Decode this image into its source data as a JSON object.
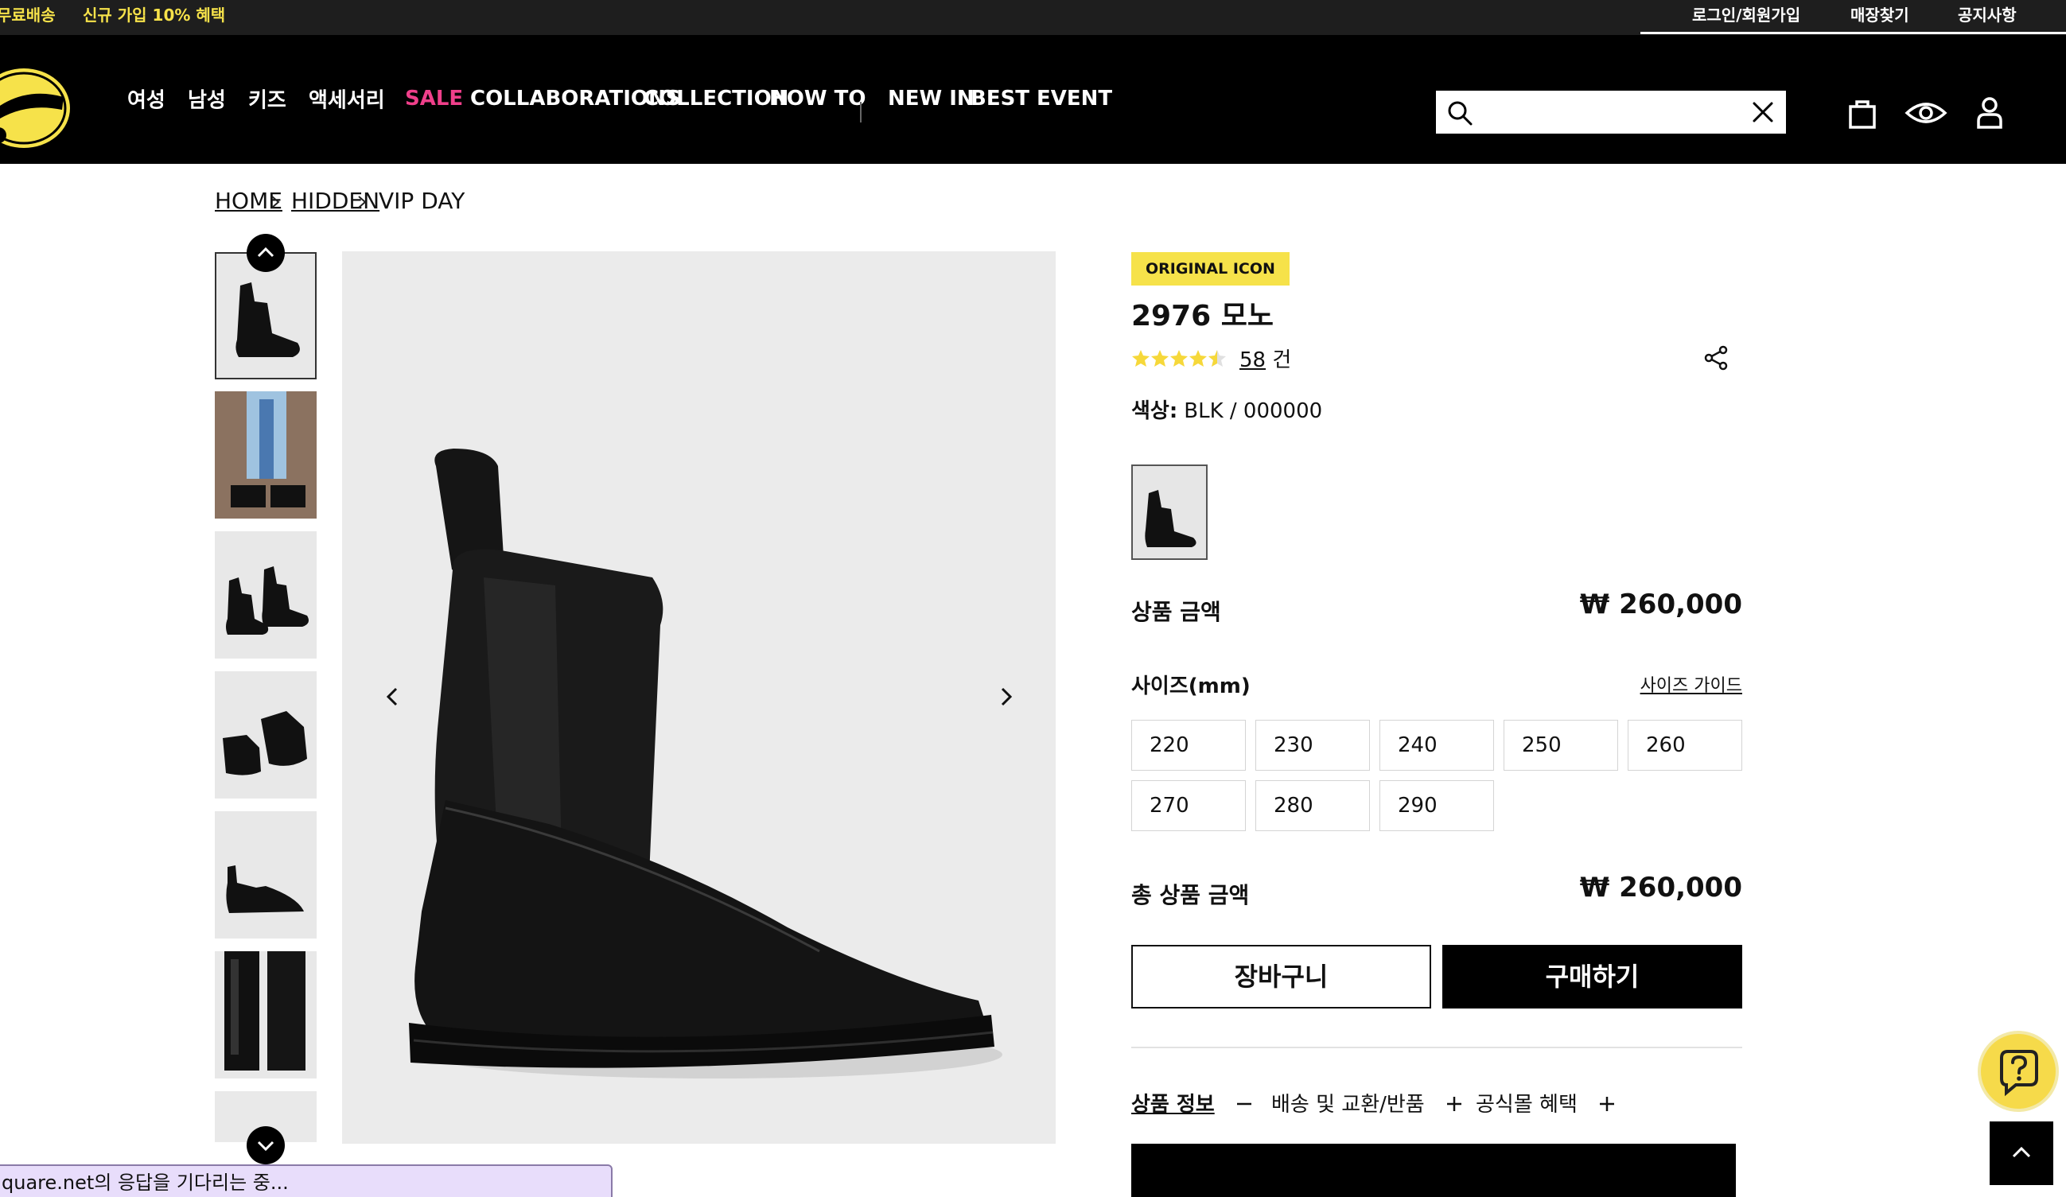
{
  "topbar": {
    "promo_free_shipping": "무료배송",
    "promo_signup_prefix": "신규 가입 ",
    "promo_signup_bold": "10%",
    "promo_signup_suffix": " 혜택",
    "login": "로그인/회원가입",
    "store_finder": "매장찾기",
    "notice": "공지사항"
  },
  "nav": {
    "items": [
      {
        "label": "여성"
      },
      {
        "label": "남성"
      },
      {
        "label": "키즈"
      },
      {
        "label": "액세서리"
      },
      {
        "label": "SALE"
      },
      {
        "label": "COLLABORATIONS"
      },
      {
        "label": "COLLECTION"
      },
      {
        "label": "HOW TO"
      },
      {
        "label": "NEW IN"
      },
      {
        "label": "BEST"
      },
      {
        "label": "EVENT"
      }
    ],
    "sale_color": "#ef3f8a"
  },
  "search": {
    "value": "",
    "placeholder": ""
  },
  "icons": {
    "search": "search-icon",
    "clear": "close-icon",
    "cart": "shopping-bag-icon",
    "recent": "eye-icon",
    "account": "user-icon",
    "share": "share-icon",
    "help": "help-question-icon",
    "scroll_top": "chevron-up-icon"
  },
  "breadcrumb": {
    "home": "HOME",
    "category": "HIDDEN",
    "current": "VIP DAY"
  },
  "product": {
    "badge": "ORIGINAL ICON",
    "name": "2976 모노",
    "rating": 4.5,
    "review_count": "58",
    "review_unit": " 건",
    "color_label": "색상:",
    "color_value": "BLK / 000000",
    "price_label": "상품 금액",
    "price": "₩ 260,000",
    "size_label": "사이즈(mm)",
    "size_guide": "사이즈 가이드",
    "sizes": [
      "220",
      "230",
      "240",
      "250",
      "260",
      "270",
      "280",
      "290"
    ],
    "total_label": "총 상품 금액",
    "total": "₩ 260,000",
    "cart_button": "장바구니",
    "buy_button": "구매하기"
  },
  "info_tabs": [
    {
      "label": "상품 정보",
      "state": "open"
    },
    {
      "label": "배송 및 교환/반품",
      "state": "closed"
    },
    {
      "label": "공식몰 혜택",
      "state": "closed"
    }
  ],
  "status_bar": "quare.net의 응답을 기다리는 중...",
  "colors": {
    "accent_yellow": "#f6e24a",
    "header_bg": "#000000",
    "toast_bg": "#e8ddfb"
  }
}
